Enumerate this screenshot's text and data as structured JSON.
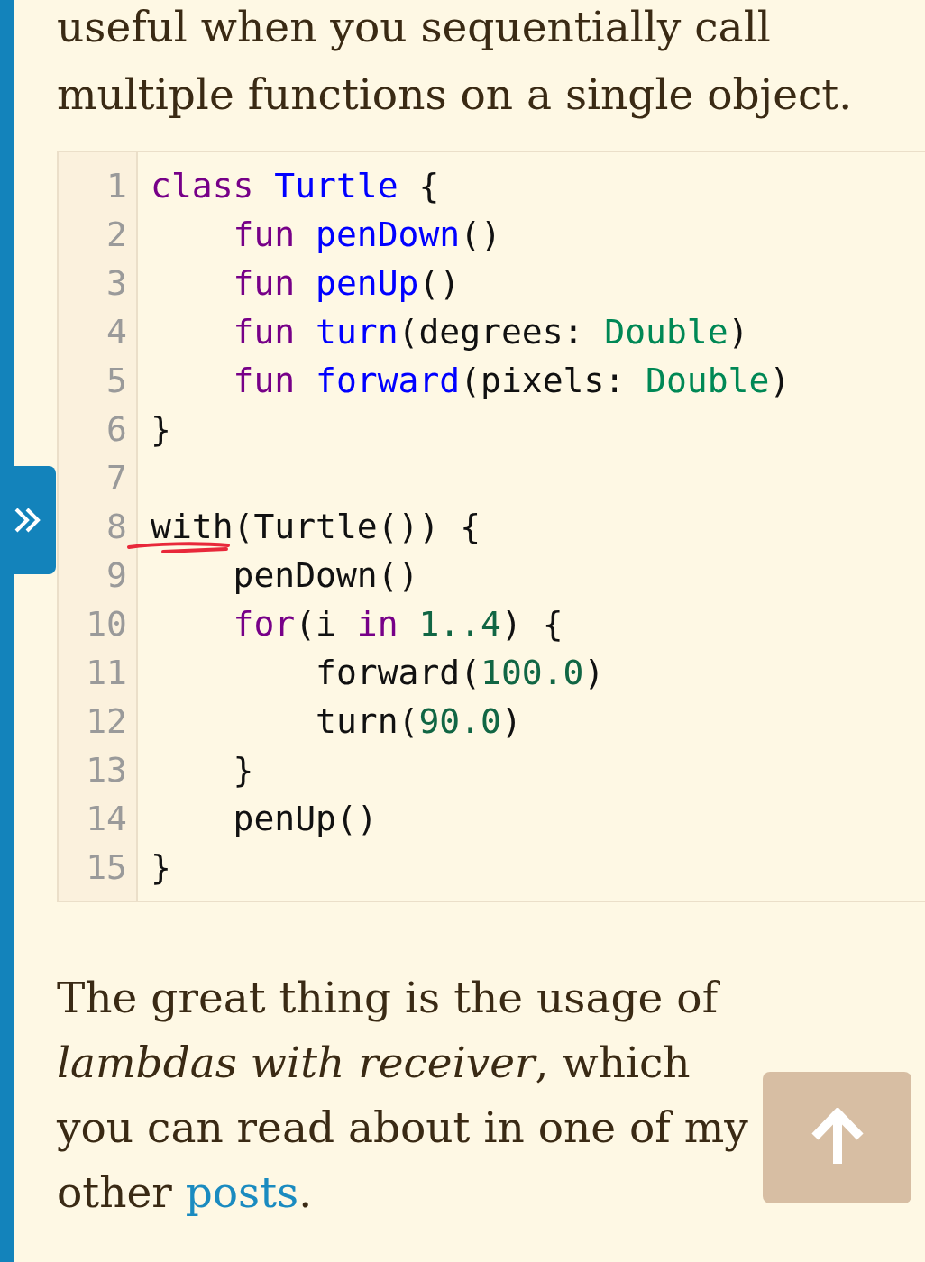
{
  "intro": "useful when you sequentially call multiple functions on a single object.",
  "code": {
    "lines": [
      {
        "number": "1",
        "annotated": false,
        "tokens": [
          {
            "kind": "keyword",
            "text": "class"
          },
          {
            "kind": "def",
            "text": " Turtle"
          },
          {
            "kind": "plain",
            "text": " {"
          }
        ]
      },
      {
        "number": "2",
        "annotated": false,
        "tokens": [
          {
            "kind": "keyword",
            "text": "    fun"
          },
          {
            "kind": "def",
            "text": " penDown"
          },
          {
            "kind": "plain",
            "text": "()"
          }
        ]
      },
      {
        "number": "3",
        "annotated": false,
        "tokens": [
          {
            "kind": "keyword",
            "text": "    fun"
          },
          {
            "kind": "def",
            "text": " penUp"
          },
          {
            "kind": "plain",
            "text": "()"
          }
        ]
      },
      {
        "number": "4",
        "annotated": false,
        "tokens": [
          {
            "kind": "keyword",
            "text": "    fun"
          },
          {
            "kind": "def",
            "text": " turn"
          },
          {
            "kind": "plain",
            "text": "(degrees:"
          },
          {
            "kind": "type",
            "text": " Double"
          },
          {
            "kind": "plain",
            "text": ")"
          }
        ]
      },
      {
        "number": "5",
        "annotated": false,
        "tokens": [
          {
            "kind": "keyword",
            "text": "    fun"
          },
          {
            "kind": "def",
            "text": " forward"
          },
          {
            "kind": "plain",
            "text": "(pixels:"
          },
          {
            "kind": "type",
            "text": " Double"
          },
          {
            "kind": "plain",
            "text": ")"
          }
        ]
      },
      {
        "number": "6",
        "annotated": false,
        "tokens": [
          {
            "kind": "plain",
            "text": "}"
          }
        ]
      },
      {
        "number": "7",
        "annotated": false
      },
      {
        "number": "8",
        "annotated": true,
        "tokens": [
          {
            "kind": "plain",
            "text": "with(Turtle()) {"
          }
        ]
      },
      {
        "number": "9",
        "annotated": false,
        "tokens": [
          {
            "kind": "plain",
            "text": "    penDown()"
          }
        ]
      },
      {
        "number": "10",
        "annotated": false,
        "tokens": [
          {
            "kind": "keyword",
            "text": "    for"
          },
          {
            "kind": "plain",
            "text": "(i"
          },
          {
            "kind": "keyword",
            "text": " in"
          },
          {
            "kind": "number",
            "text": " 1..4"
          },
          {
            "kind": "plain",
            "text": ") {"
          }
        ]
      },
      {
        "number": "11",
        "annotated": false,
        "tokens": [
          {
            "kind": "plain",
            "text": "        forward("
          },
          {
            "kind": "number",
            "text": "100.0"
          },
          {
            "kind": "plain",
            "text": ")"
          }
        ]
      },
      {
        "number": "12",
        "annotated": false,
        "tokens": [
          {
            "kind": "plain",
            "text": "        turn("
          },
          {
            "kind": "number",
            "text": "90.0"
          },
          {
            "kind": "plain",
            "text": ")"
          }
        ]
      },
      {
        "number": "13",
        "annotated": false,
        "tokens": [
          {
            "kind": "plain",
            "text": "    }"
          }
        ]
      },
      {
        "number": "14",
        "annotated": false,
        "tokens": [
          {
            "kind": "plain",
            "text": "    penUp()"
          }
        ]
      },
      {
        "number": "15",
        "annotated": false,
        "tokens": [
          {
            "kind": "plain",
            "text": "}"
          }
        ]
      }
    ]
  },
  "paragraph": {
    "text": "The great thing is the usage of *lambdas with receiver*, which you can read about in one of my other ",
    "link": "posts",
    "after": "."
  }
}
